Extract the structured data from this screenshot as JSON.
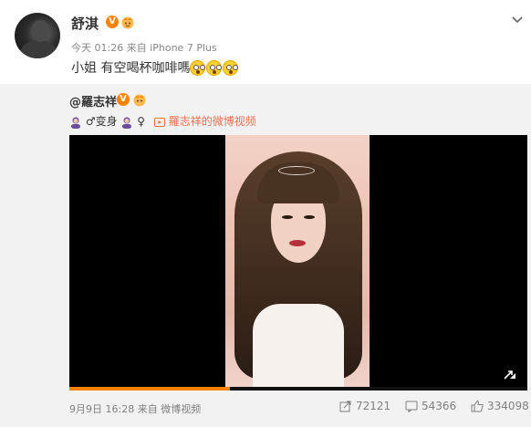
{
  "post": {
    "username": "舒淇",
    "v_badge": "V",
    "time": "今天 01:26",
    "source": "来自 iPhone 7 Plus",
    "text": "小姐 有空喝杯咖啡嗎"
  },
  "repost": {
    "author": "@羅志祥",
    "v_badge": "V",
    "text_middle": "♂变身",
    "text_after": "♀",
    "video_link": "羅志祥的微博视频",
    "video": {
      "progress_fraction": 0.35
    },
    "date": "9月9日 16:28",
    "source": "来自 微博视频",
    "reposts": "72121",
    "comments": "54366",
    "likes": "334098"
  },
  "icons": {
    "verified": "v-verified-icon",
    "crown": "vip-crown-icon",
    "chevron": "chevron-down-icon",
    "emoji": "shocked-face-icon",
    "person": "person-emoji-icon",
    "video_link": "video-link-icon",
    "fullscreen": "expand-icon",
    "repost": "repost-icon",
    "comment": "comment-icon",
    "like": "thumbs-up-icon"
  },
  "colors": {
    "accent": "#ff8200",
    "link": "#eb7350",
    "repost_bg": "#f2f2f2",
    "meta_text": "#808080"
  }
}
